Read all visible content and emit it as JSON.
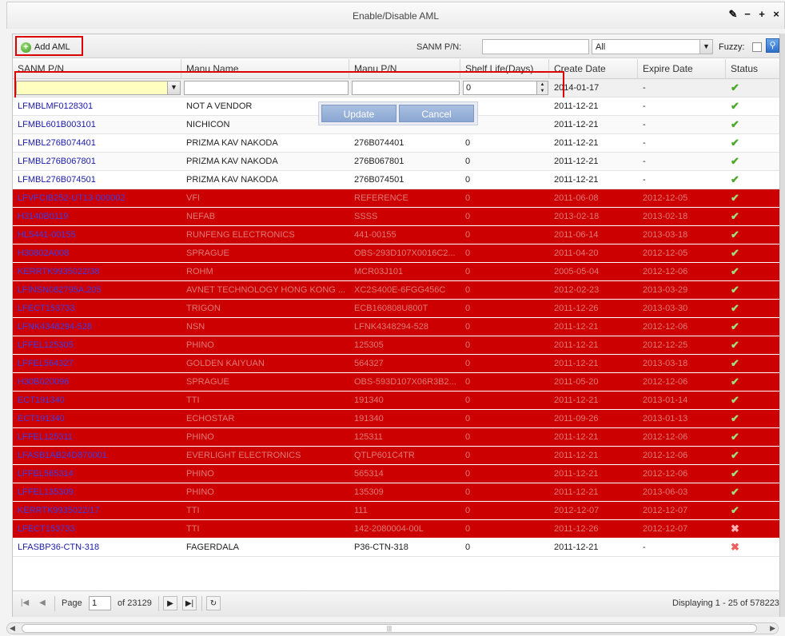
{
  "window": {
    "title": "Enable/Disable AML",
    "tools": [
      "✎",
      "−",
      "+",
      "×"
    ]
  },
  "toolbar": {
    "add_label": "Add AML",
    "sanm_label": "SANM P/N:",
    "sanm_value": "",
    "filter_value": "All",
    "fuzzy_label": "Fuzzy:"
  },
  "columns": [
    "SANM P/N",
    "Manu Name",
    "Manu P/N",
    "Shelf Life(Days)",
    "Create Date",
    "Expire Date",
    "Status"
  ],
  "editor": {
    "shelf_value": "0",
    "create_date": "2014-01-17",
    "expire_date": "-",
    "update_label": "Update",
    "cancel_label": "Cancel"
  },
  "rows": [
    {
      "pn": "LFMBLMF0128301",
      "name": "NOT A VENDOR",
      "mpn": "",
      "shelf": "",
      "create": "2011-12-21",
      "expire": "-",
      "status": "ok",
      "red": false
    },
    {
      "pn": "LFMBL601B003101",
      "name": "NICHICON",
      "mpn": "",
      "shelf": "",
      "create": "2011-12-21",
      "expire": "-",
      "status": "ok",
      "red": false
    },
    {
      "pn": "LFMBL276B074401",
      "name": "PRIZMA KAV NAKODA",
      "mpn": "276B074401",
      "shelf": "0",
      "create": "2011-12-21",
      "expire": "-",
      "status": "ok",
      "red": false
    },
    {
      "pn": "LFMBL276B067801",
      "name": "PRIZMA KAV NAKODA",
      "mpn": "276B067801",
      "shelf": "0",
      "create": "2011-12-21",
      "expire": "-",
      "status": "ok",
      "red": false
    },
    {
      "pn": "LFMBL276B074501",
      "name": "PRIZMA KAV NAKODA",
      "mpn": "276B074501",
      "shelf": "0",
      "create": "2011-12-21",
      "expire": "-",
      "status": "ok",
      "red": false
    },
    {
      "pn": "LFVFCIB252-UT13-000002",
      "name": "VFI",
      "mpn": "REFERENCE",
      "shelf": "0",
      "create": "2011-06-08",
      "expire": "2012-12-05",
      "status": "ok",
      "red": true
    },
    {
      "pn": "H3140B0119",
      "name": "NEFAB",
      "mpn": "SSSS",
      "shelf": "0",
      "create": "2013-02-18",
      "expire": "2013-02-18",
      "status": "ok",
      "red": true
    },
    {
      "pn": "HL5441-00155",
      "name": "RUNFENG ELECTRONICS",
      "mpn": "441-00155",
      "shelf": "0",
      "create": "2011-06-14",
      "expire": "2013-03-18",
      "status": "ok",
      "red": true
    },
    {
      "pn": "H30802A008",
      "name": "SPRAGUE",
      "mpn": "OBS-293D107X0016C2...",
      "shelf": "0",
      "create": "2011-04-20",
      "expire": "2012-12-05",
      "status": "ok",
      "red": true
    },
    {
      "pn": "KERRTK9935022/38",
      "name": "ROHM",
      "mpn": "MCR03J101",
      "shelf": "0",
      "create": "2005-05-04",
      "expire": "2012-12-06",
      "status": "ok",
      "red": true
    },
    {
      "pn": "LFINSN082795A.205",
      "name": "AVNET TECHNOLOGY HONG KONG ...",
      "mpn": "XC2S400E-6FGG456C",
      "shelf": "0",
      "create": "2012-02-23",
      "expire": "2013-03-29",
      "status": "ok",
      "red": true
    },
    {
      "pn": "LFECT153733",
      "name": "TRIGON",
      "mpn": "ECB160808U800T",
      "shelf": "0",
      "create": "2011-12-26",
      "expire": "2013-03-30",
      "status": "ok",
      "red": true
    },
    {
      "pn": "LFNK4348294-528",
      "name": "NSN",
      "mpn": "LFNK4348294-528",
      "shelf": "0",
      "create": "2011-12-21",
      "expire": "2012-12-06",
      "status": "ok",
      "red": true
    },
    {
      "pn": "LFFEL125305",
      "name": "PHINO",
      "mpn": "125305",
      "shelf": "0",
      "create": "2011-12-21",
      "expire": "2012-12-25",
      "status": "ok",
      "red": true
    },
    {
      "pn": "LFFEL564327",
      "name": "GOLDEN KAIYUAN",
      "mpn": "564327",
      "shelf": "0",
      "create": "2011-12-21",
      "expire": "2013-03-18",
      "status": "ok",
      "red": true
    },
    {
      "pn": "H30B020096",
      "name": "SPRAGUE",
      "mpn": "OBS-593D107X06R3B2...",
      "shelf": "0",
      "create": "2011-05-20",
      "expire": "2012-12-06",
      "status": "ok",
      "red": true
    },
    {
      "pn": "ECT191340",
      "name": "TTI",
      "mpn": "191340",
      "shelf": "0",
      "create": "2011-12-21",
      "expire": "2013-01-14",
      "status": "ok",
      "red": true
    },
    {
      "pn": "ECT191340",
      "name": "ECHOSTAR",
      "mpn": "191340",
      "shelf": "0",
      "create": "2011-09-26",
      "expire": "2013-01-13",
      "status": "ok",
      "red": true
    },
    {
      "pn": "LFFEL125311",
      "name": "PHINO",
      "mpn": "125311",
      "shelf": "0",
      "create": "2011-12-21",
      "expire": "2012-12-06",
      "status": "ok",
      "red": true
    },
    {
      "pn": "LFASB1AB24D870001",
      "name": "EVERLIGHT ELECTRONICS",
      "mpn": "QTLP601C4TR",
      "shelf": "0",
      "create": "2011-12-21",
      "expire": "2012-12-06",
      "status": "ok",
      "red": true
    },
    {
      "pn": "LFFEL565314",
      "name": "PHINO",
      "mpn": "565314",
      "shelf": "0",
      "create": "2011-12-21",
      "expire": "2012-12-06",
      "status": "ok",
      "red": true
    },
    {
      "pn": "LFFEL135309",
      "name": "PHINO",
      "mpn": "135309",
      "shelf": "0",
      "create": "2011-12-21",
      "expire": "2013-06-03",
      "status": "ok",
      "red": true
    },
    {
      "pn": "KERRTK9935022/17",
      "name": "TTI",
      "mpn": "111",
      "shelf": "0",
      "create": "2012-12-07",
      "expire": "2012-12-07",
      "status": "ok",
      "red": true
    },
    {
      "pn": "LFECT153733",
      "name": "TTI",
      "mpn": "142-2080004-00L",
      "shelf": "0",
      "create": "2011-12-26",
      "expire": "2012-12-07",
      "status": "no",
      "red": true
    },
    {
      "pn": "LFASBP36-CTN-318",
      "name": "FAGERDALA",
      "mpn": "P36-CTN-318",
      "shelf": "0",
      "create": "2011-12-21",
      "expire": "-",
      "status": "no",
      "red": false
    }
  ],
  "pager": {
    "page_label": "Page",
    "page_value": "1",
    "of_label": "of 23129",
    "display": "Displaying 1 - 25 of 578223"
  }
}
